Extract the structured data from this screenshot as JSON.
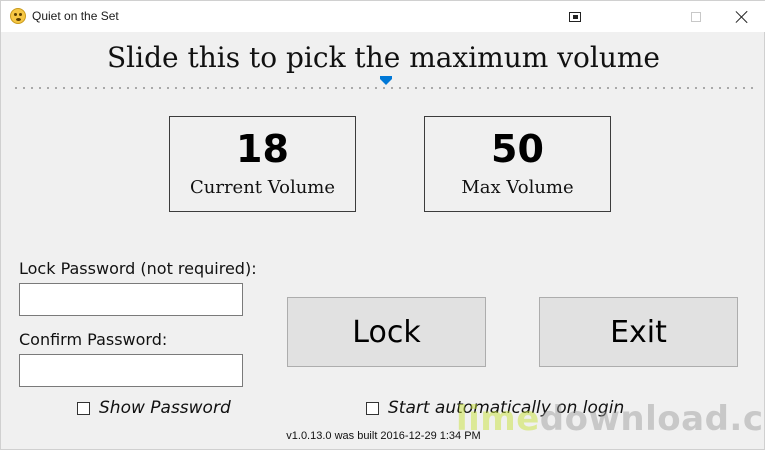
{
  "window": {
    "title": "Quiet on the Set"
  },
  "slider": {
    "instruction": "Slide this to pick the maximum volume",
    "value": 50,
    "min": 0,
    "max": 100
  },
  "panels": {
    "current": {
      "value": "18",
      "caption": "Current Volume"
    },
    "max": {
      "value": "50",
      "caption": "Max Volume"
    }
  },
  "form": {
    "lock_password_label": "Lock Password (not required):",
    "lock_password_value": "",
    "confirm_password_label": "Confirm Password:",
    "confirm_password_value": ""
  },
  "buttons": {
    "lock": "Lock",
    "exit": "Exit"
  },
  "checkboxes": {
    "show_password": {
      "label": "Show Password",
      "checked": false
    },
    "start_auto": {
      "label": "Start automatically on login",
      "checked": false
    }
  },
  "footer": {
    "version": "v1.0.13.0 was built 2016-12-29 1:34 PM"
  },
  "watermark": {
    "part1": "lime",
    "part2": "download.com"
  },
  "colors": {
    "background": "#f0f0f0",
    "thumb": "#0078d7"
  },
  "icons": {
    "app": "smiley-face-icon",
    "pin": "pin-window-icon",
    "maximize": "maximize-icon",
    "close": "close-icon"
  }
}
